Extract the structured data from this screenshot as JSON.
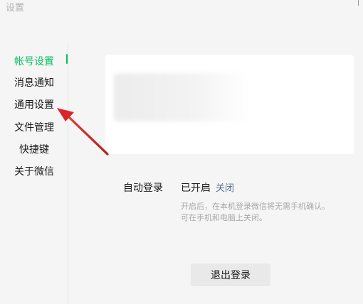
{
  "window": {
    "title": "设置"
  },
  "sidebar": {
    "items": [
      {
        "label": "帐号设置",
        "active": true
      },
      {
        "label": "消息通知",
        "active": false
      },
      {
        "label": "通用设置",
        "active": false
      },
      {
        "label": "文件管理",
        "active": false
      },
      {
        "label": "快捷键",
        "active": false
      },
      {
        "label": "关于微信",
        "active": false
      }
    ]
  },
  "account": {
    "auto_login_label": "自动登录",
    "auto_login_status": "已开启",
    "auto_login_action": "关闭",
    "hint_line1": "开启后，在本机登录微信将无需手机确认。",
    "hint_line2": "可在手机和电脑上关闭。",
    "logout_label": "退出登录"
  },
  "colors": {
    "accent": "#07c160",
    "link": "#576b95",
    "annotation_arrow": "#d8262a"
  }
}
